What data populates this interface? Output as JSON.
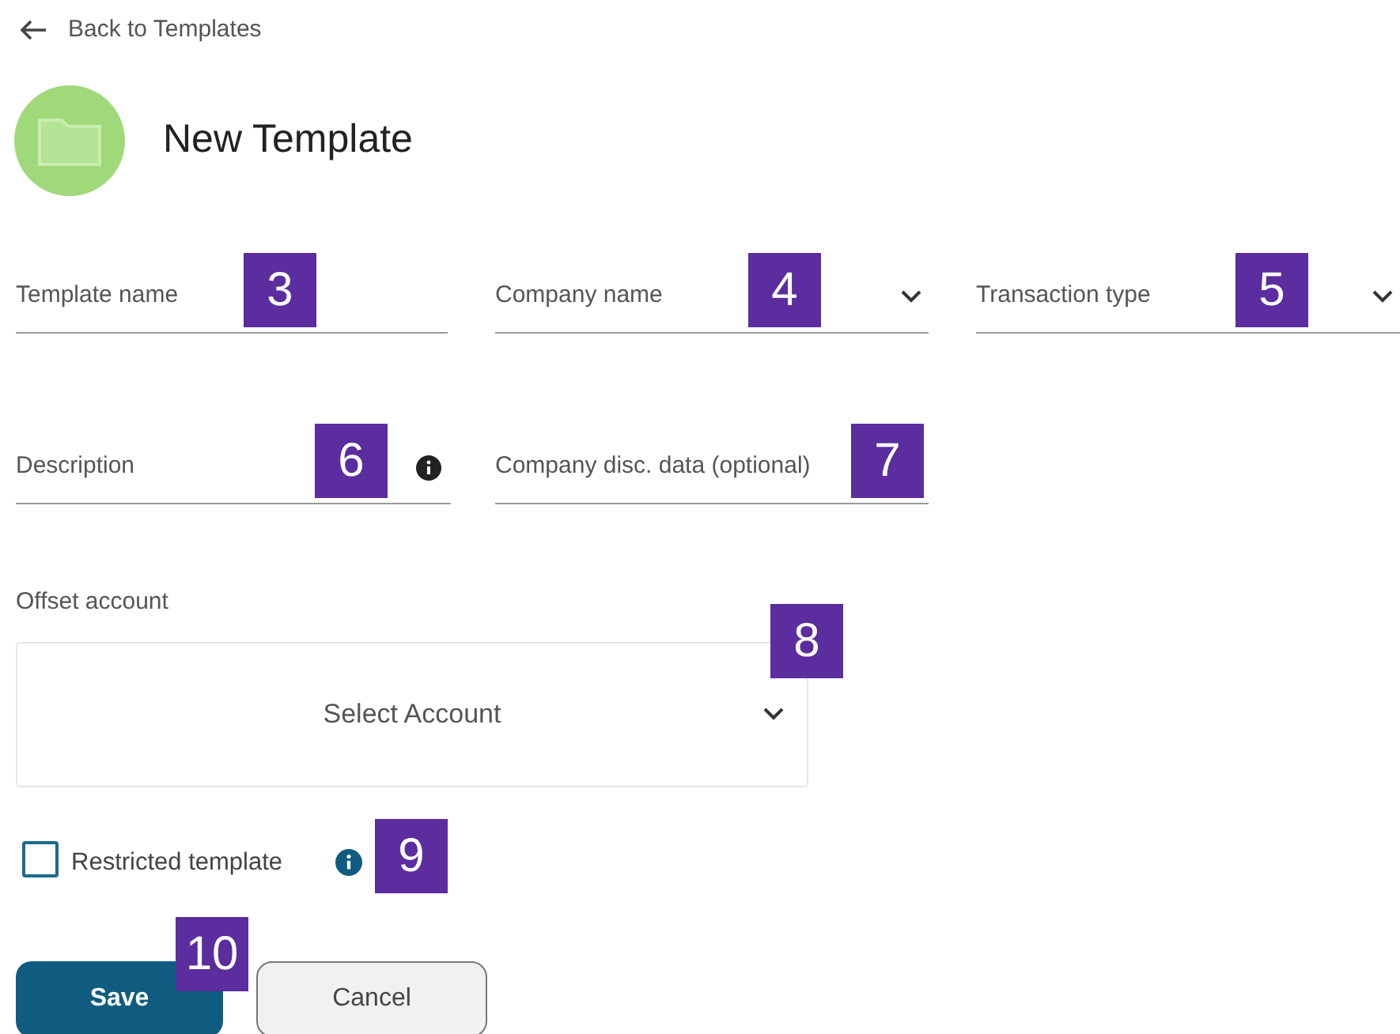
{
  "back_link": {
    "label": "Back to Templates"
  },
  "page_title": "New Template",
  "fields": [
    {
      "kind": "text",
      "label": "Template name",
      "callout": "3"
    },
    {
      "kind": "select",
      "label": "Company name",
      "callout": "4"
    },
    {
      "kind": "select",
      "label": "Transaction type",
      "callout": "5"
    },
    {
      "kind": "info",
      "label": "Description",
      "callout": "6"
    },
    {
      "kind": "text",
      "label": "Company disc. data (optional)",
      "callout": "7"
    }
  ],
  "offset_account": {
    "label": "Offset account",
    "placeholder": "Select Account",
    "callout": "8"
  },
  "restricted": {
    "label": "Restricted template",
    "checked": false,
    "callout": "9"
  },
  "buttons": [
    {
      "kind": "primary",
      "label": "Save",
      "callout": "10"
    },
    {
      "kind": "secondary",
      "label": "Cancel"
    }
  ]
}
